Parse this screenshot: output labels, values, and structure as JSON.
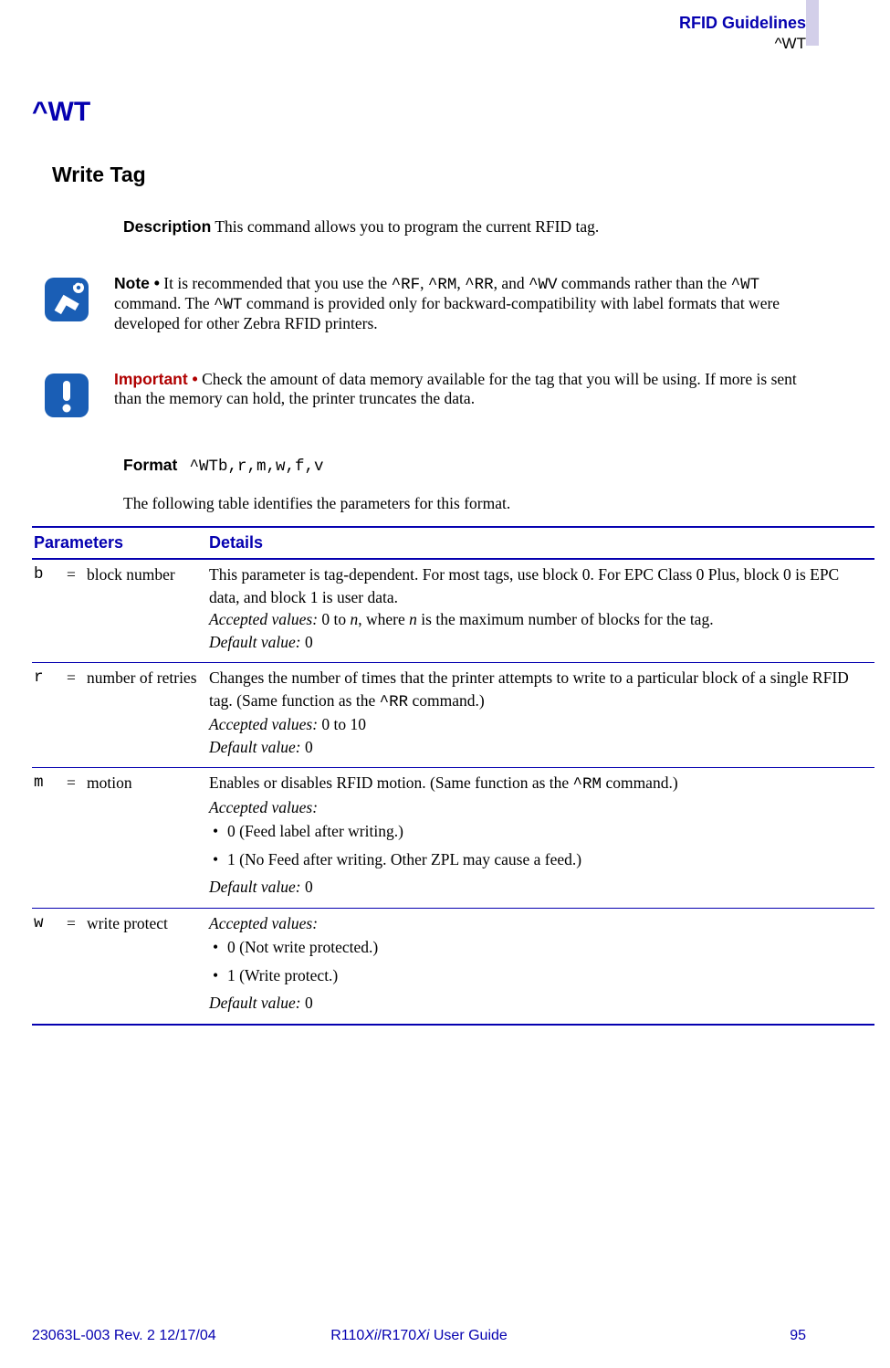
{
  "header": {
    "guide_section": "RFID Guidelines",
    "command": "^WT"
  },
  "title": "^WT",
  "subtitle": "Write Tag",
  "description": {
    "label": "Description",
    "text_pre": "  This command allows you to program the current RFID tag."
  },
  "note": {
    "label": "Note •",
    "text_1": " It is recommended that you use the ",
    "code_rf": "^RF",
    "sep1": ", ",
    "code_rm": "^RM",
    "sep2": ", ",
    "code_rr": "^RR",
    "sep3": ", and ",
    "code_wv": "^WV",
    "text_2": " commands rather than the ",
    "code_wt1": "^WT",
    "text_3": " command. The ",
    "code_wt2": "^WT",
    "text_4": " command is provided only for backward-compatibility with label formats that were developed for other Zebra RFID printers."
  },
  "important": {
    "label": "Important •",
    "text": " Check the amount of data memory available for the tag that you will be using. If more is sent than the memory can hold, the printer truncates the data."
  },
  "format": {
    "label": "Format",
    "code": "^WTb,r,m,w,f,v"
  },
  "table_intro": "The following table identifies the parameters for this format.",
  "table": {
    "headers": {
      "parameters": "Parameters",
      "details": "Details"
    },
    "rows": [
      {
        "code": "b",
        "eq": "=",
        "name": "block number",
        "details_1": "This parameter is tag-dependent. For most tags, use block 0. For EPC Class 0 Plus, block 0 is EPC data, and block 1 is user data.",
        "accepted_label": "Accepted values:",
        "accepted_pre": " 0 to ",
        "accepted_n1": "n",
        "accepted_mid": ", where ",
        "accepted_n2": "n",
        "accepted_post": " is the maximum number of blocks for the tag.",
        "default_label": "Default value:",
        "default_value": " 0"
      },
      {
        "code": "r",
        "eq": "=",
        "name": "number of retries",
        "details_1_pre": "Changes the number of times that the printer attempts to write to a particular block of a single RFID tag. (Same function as the ",
        "details_1_code": "^RR",
        "details_1_post": " command.)",
        "accepted_label": "Accepted values:",
        "accepted_value": " 0 to 10",
        "default_label": "Default value:",
        "default_value": " 0"
      },
      {
        "code": "m",
        "eq": "=",
        "name": "motion",
        "details_1_pre": "Enables or disables RFID motion. (Same function as the ",
        "details_1_code": "^RM",
        "details_1_post": " command.)",
        "accepted_label": "Accepted values:",
        "bullets": [
          "0 (Feed label after writing.)",
          "1 (No Feed after writing. Other ZPL may cause a feed.)"
        ],
        "default_label": "Default value:",
        "default_value": " 0"
      },
      {
        "code": "w",
        "eq": "=",
        "name": "write protect",
        "accepted_label": "Accepted values:",
        "bullets": [
          "0 (Not write protected.)",
          "1 (Write protect.)"
        ],
        "default_label": "Default value:",
        "default_value": " 0"
      }
    ]
  },
  "footer": {
    "left": "23063L-003 Rev. 2    12/17/04",
    "center_pre": "R110",
    "center_xi1": "Xi",
    "center_mid": "/R170",
    "center_xi2": "Xi",
    "center_post": " User Guide",
    "page": "95"
  }
}
